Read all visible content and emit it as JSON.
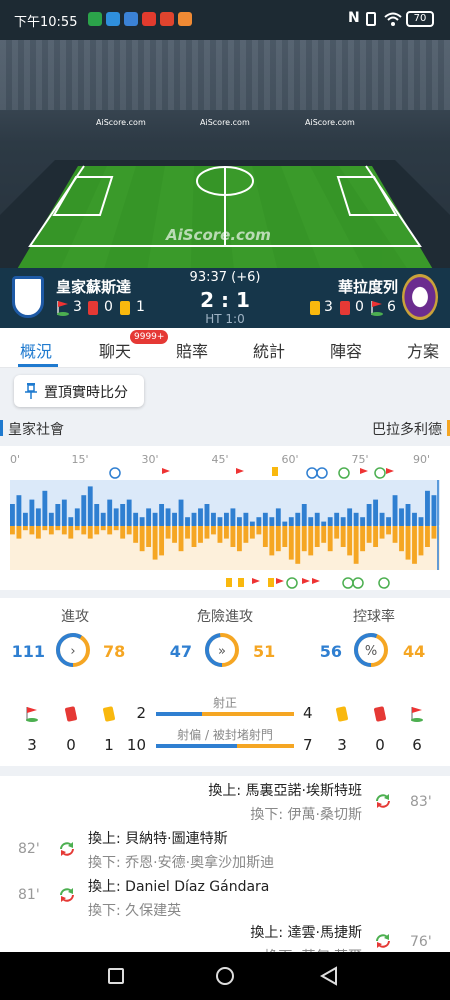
{
  "status_bar": {
    "time": "下午10:55",
    "network": "N",
    "battery": "70"
  },
  "stadium": {
    "ad_text": "AiScore.com",
    "watermark": "AiScore.com"
  },
  "match": {
    "home_team": "皇家蘇斯達",
    "away_team": "華拉度列",
    "clock": "93:37 (+6)",
    "score": "2 : 1",
    "halftime": "HT 1:0",
    "home_corners": "3",
    "home_red": "0",
    "home_yellow": "1",
    "away_yellow": "3",
    "away_red": "0",
    "away_corners": "6",
    "home_color": "#1e5aa6",
    "away_color": "#6b2c8f"
  },
  "tabs": [
    {
      "label": "概況",
      "active": true
    },
    {
      "label": "聊天",
      "badge": "9999+"
    },
    {
      "label": "賠率"
    },
    {
      "label": "統計"
    },
    {
      "label": "陣容"
    },
    {
      "label": "方案"
    }
  ],
  "pin_button": {
    "label": "置頂實時比分"
  },
  "team_labels": {
    "home": "皇家社會",
    "away": "巴拉多利德"
  },
  "timeline": {
    "ticks": [
      "0'",
      "15'",
      "30'",
      "45'",
      "60'",
      "75'",
      "90'"
    ],
    "home_color": "#2f7fd1",
    "away_color": "#f5a623",
    "home_bars": [
      0.5,
      0.7,
      0.3,
      0.6,
      0.4,
      0.8,
      0.3,
      0.5,
      0.6,
      0.2,
      0.4,
      0.7,
      0.9,
      0.5,
      0.3,
      0.6,
      0.4,
      0.5,
      0.6,
      0.3,
      0.2,
      0.4,
      0.3,
      0.5,
      0.4,
      0.3,
      0.6,
      0.2,
      0.3,
      0.4,
      0.5,
      0.3,
      0.2,
      0.3,
      0.4,
      0.2,
      0.3,
      0.1,
      0.2,
      0.3,
      0.2,
      0.4,
      0.1,
      0.2,
      0.3,
      0.5,
      0.2,
      0.3,
      0.1,
      0.2,
      0.3,
      0.2,
      0.4,
      0.3,
      0.2,
      0.5,
      0.6,
      0.3,
      0.2,
      0.7,
      0.4,
      0.5,
      0.3,
      0.2,
      0.8,
      0.7
    ],
    "away_bars": [
      0.2,
      0.3,
      0.1,
      0.2,
      0.3,
      0.1,
      0.2,
      0.1,
      0.2,
      0.3,
      0.1,
      0.2,
      0.3,
      0.2,
      0.1,
      0.2,
      0.1,
      0.3,
      0.2,
      0.4,
      0.6,
      0.5,
      0.8,
      0.7,
      0.3,
      0.4,
      0.6,
      0.3,
      0.5,
      0.4,
      0.3,
      0.2,
      0.4,
      0.3,
      0.5,
      0.6,
      0.4,
      0.3,
      0.2,
      0.5,
      0.7,
      0.6,
      0.5,
      0.8,
      0.9,
      0.6,
      0.7,
      0.5,
      0.4,
      0.6,
      0.3,
      0.5,
      0.7,
      0.9,
      0.6,
      0.4,
      0.5,
      0.3,
      0.2,
      0.4,
      0.6,
      0.8,
      0.9,
      0.7,
      0.5,
      0.3
    ]
  },
  "stats": {
    "attack": {
      "label": "進攻",
      "home": "111",
      "away": "78",
      "home_frac": 0.587
    },
    "dangerous": {
      "label": "危險進攻",
      "home": "47",
      "away": "51",
      "home_frac": 0.48
    },
    "possession": {
      "label": "控球率",
      "home": "56",
      "away": "44",
      "home_frac": 0.56
    },
    "on_target": {
      "label": "射正",
      "home": "2",
      "away": "4"
    },
    "off_target": {
      "label": "射偏 / 被封堵射門",
      "home": "10",
      "away": "7"
    },
    "home_corners": "3",
    "home_red": "0",
    "home_yellow": "1",
    "away_yellow": "3",
    "away_red": "0",
    "away_corners": "6"
  },
  "events": [
    {
      "side": "away",
      "in": "換上: 馬裏亞諾·埃斯特班",
      "out": "換下: 伊萬·桑切斯",
      "minute": "83'"
    },
    {
      "side": "home",
      "in": "換上: 貝納特·圖連特斯",
      "out": "換下: 乔恩·安德·奧拿沙加斯迪",
      "minute": "82'"
    },
    {
      "side": "home",
      "in": "換上: Daniel Díaz Gándara",
      "out": "換下: 久保建英",
      "minute": "81'"
    },
    {
      "side": "away",
      "in": "換上: 達雲·馬捷斯",
      "out": "換下: 莫匈·莫爾",
      "minute": "76'"
    }
  ]
}
